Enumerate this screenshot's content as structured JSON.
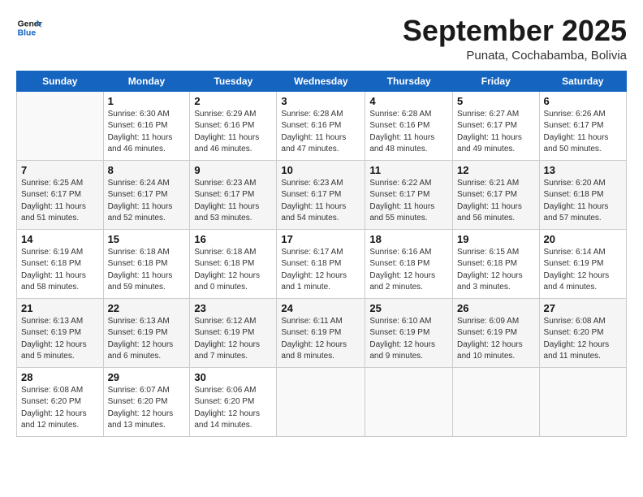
{
  "logo": {
    "general": "General",
    "blue": "Blue"
  },
  "header": {
    "month": "September 2025",
    "location": "Punata, Cochabamba, Bolivia"
  },
  "weekdays": [
    "Sunday",
    "Monday",
    "Tuesday",
    "Wednesday",
    "Thursday",
    "Friday",
    "Saturday"
  ],
  "weeks": [
    [
      {
        "day": "",
        "info": ""
      },
      {
        "day": "1",
        "info": "Sunrise: 6:30 AM\nSunset: 6:16 PM\nDaylight: 11 hours\nand 46 minutes."
      },
      {
        "day": "2",
        "info": "Sunrise: 6:29 AM\nSunset: 6:16 PM\nDaylight: 11 hours\nand 46 minutes."
      },
      {
        "day": "3",
        "info": "Sunrise: 6:28 AM\nSunset: 6:16 PM\nDaylight: 11 hours\nand 47 minutes."
      },
      {
        "day": "4",
        "info": "Sunrise: 6:28 AM\nSunset: 6:16 PM\nDaylight: 11 hours\nand 48 minutes."
      },
      {
        "day": "5",
        "info": "Sunrise: 6:27 AM\nSunset: 6:17 PM\nDaylight: 11 hours\nand 49 minutes."
      },
      {
        "day": "6",
        "info": "Sunrise: 6:26 AM\nSunset: 6:17 PM\nDaylight: 11 hours\nand 50 minutes."
      }
    ],
    [
      {
        "day": "7",
        "info": "Sunrise: 6:25 AM\nSunset: 6:17 PM\nDaylight: 11 hours\nand 51 minutes."
      },
      {
        "day": "8",
        "info": "Sunrise: 6:24 AM\nSunset: 6:17 PM\nDaylight: 11 hours\nand 52 minutes."
      },
      {
        "day": "9",
        "info": "Sunrise: 6:23 AM\nSunset: 6:17 PM\nDaylight: 11 hours\nand 53 minutes."
      },
      {
        "day": "10",
        "info": "Sunrise: 6:23 AM\nSunset: 6:17 PM\nDaylight: 11 hours\nand 54 minutes."
      },
      {
        "day": "11",
        "info": "Sunrise: 6:22 AM\nSunset: 6:17 PM\nDaylight: 11 hours\nand 55 minutes."
      },
      {
        "day": "12",
        "info": "Sunrise: 6:21 AM\nSunset: 6:17 PM\nDaylight: 11 hours\nand 56 minutes."
      },
      {
        "day": "13",
        "info": "Sunrise: 6:20 AM\nSunset: 6:18 PM\nDaylight: 11 hours\nand 57 minutes."
      }
    ],
    [
      {
        "day": "14",
        "info": "Sunrise: 6:19 AM\nSunset: 6:18 PM\nDaylight: 11 hours\nand 58 minutes."
      },
      {
        "day": "15",
        "info": "Sunrise: 6:18 AM\nSunset: 6:18 PM\nDaylight: 11 hours\nand 59 minutes."
      },
      {
        "day": "16",
        "info": "Sunrise: 6:18 AM\nSunset: 6:18 PM\nDaylight: 12 hours\nand 0 minutes."
      },
      {
        "day": "17",
        "info": "Sunrise: 6:17 AM\nSunset: 6:18 PM\nDaylight: 12 hours\nand 1 minute."
      },
      {
        "day": "18",
        "info": "Sunrise: 6:16 AM\nSunset: 6:18 PM\nDaylight: 12 hours\nand 2 minutes."
      },
      {
        "day": "19",
        "info": "Sunrise: 6:15 AM\nSunset: 6:18 PM\nDaylight: 12 hours\nand 3 minutes."
      },
      {
        "day": "20",
        "info": "Sunrise: 6:14 AM\nSunset: 6:19 PM\nDaylight: 12 hours\nand 4 minutes."
      }
    ],
    [
      {
        "day": "21",
        "info": "Sunrise: 6:13 AM\nSunset: 6:19 PM\nDaylight: 12 hours\nand 5 minutes."
      },
      {
        "day": "22",
        "info": "Sunrise: 6:13 AM\nSunset: 6:19 PM\nDaylight: 12 hours\nand 6 minutes."
      },
      {
        "day": "23",
        "info": "Sunrise: 6:12 AM\nSunset: 6:19 PM\nDaylight: 12 hours\nand 7 minutes."
      },
      {
        "day": "24",
        "info": "Sunrise: 6:11 AM\nSunset: 6:19 PM\nDaylight: 12 hours\nand 8 minutes."
      },
      {
        "day": "25",
        "info": "Sunrise: 6:10 AM\nSunset: 6:19 PM\nDaylight: 12 hours\nand 9 minutes."
      },
      {
        "day": "26",
        "info": "Sunrise: 6:09 AM\nSunset: 6:19 PM\nDaylight: 12 hours\nand 10 minutes."
      },
      {
        "day": "27",
        "info": "Sunrise: 6:08 AM\nSunset: 6:20 PM\nDaylight: 12 hours\nand 11 minutes."
      }
    ],
    [
      {
        "day": "28",
        "info": "Sunrise: 6:08 AM\nSunset: 6:20 PM\nDaylight: 12 hours\nand 12 minutes."
      },
      {
        "day": "29",
        "info": "Sunrise: 6:07 AM\nSunset: 6:20 PM\nDaylight: 12 hours\nand 13 minutes."
      },
      {
        "day": "30",
        "info": "Sunrise: 6:06 AM\nSunset: 6:20 PM\nDaylight: 12 hours\nand 14 minutes."
      },
      {
        "day": "",
        "info": ""
      },
      {
        "day": "",
        "info": ""
      },
      {
        "day": "",
        "info": ""
      },
      {
        "day": "",
        "info": ""
      }
    ]
  ]
}
